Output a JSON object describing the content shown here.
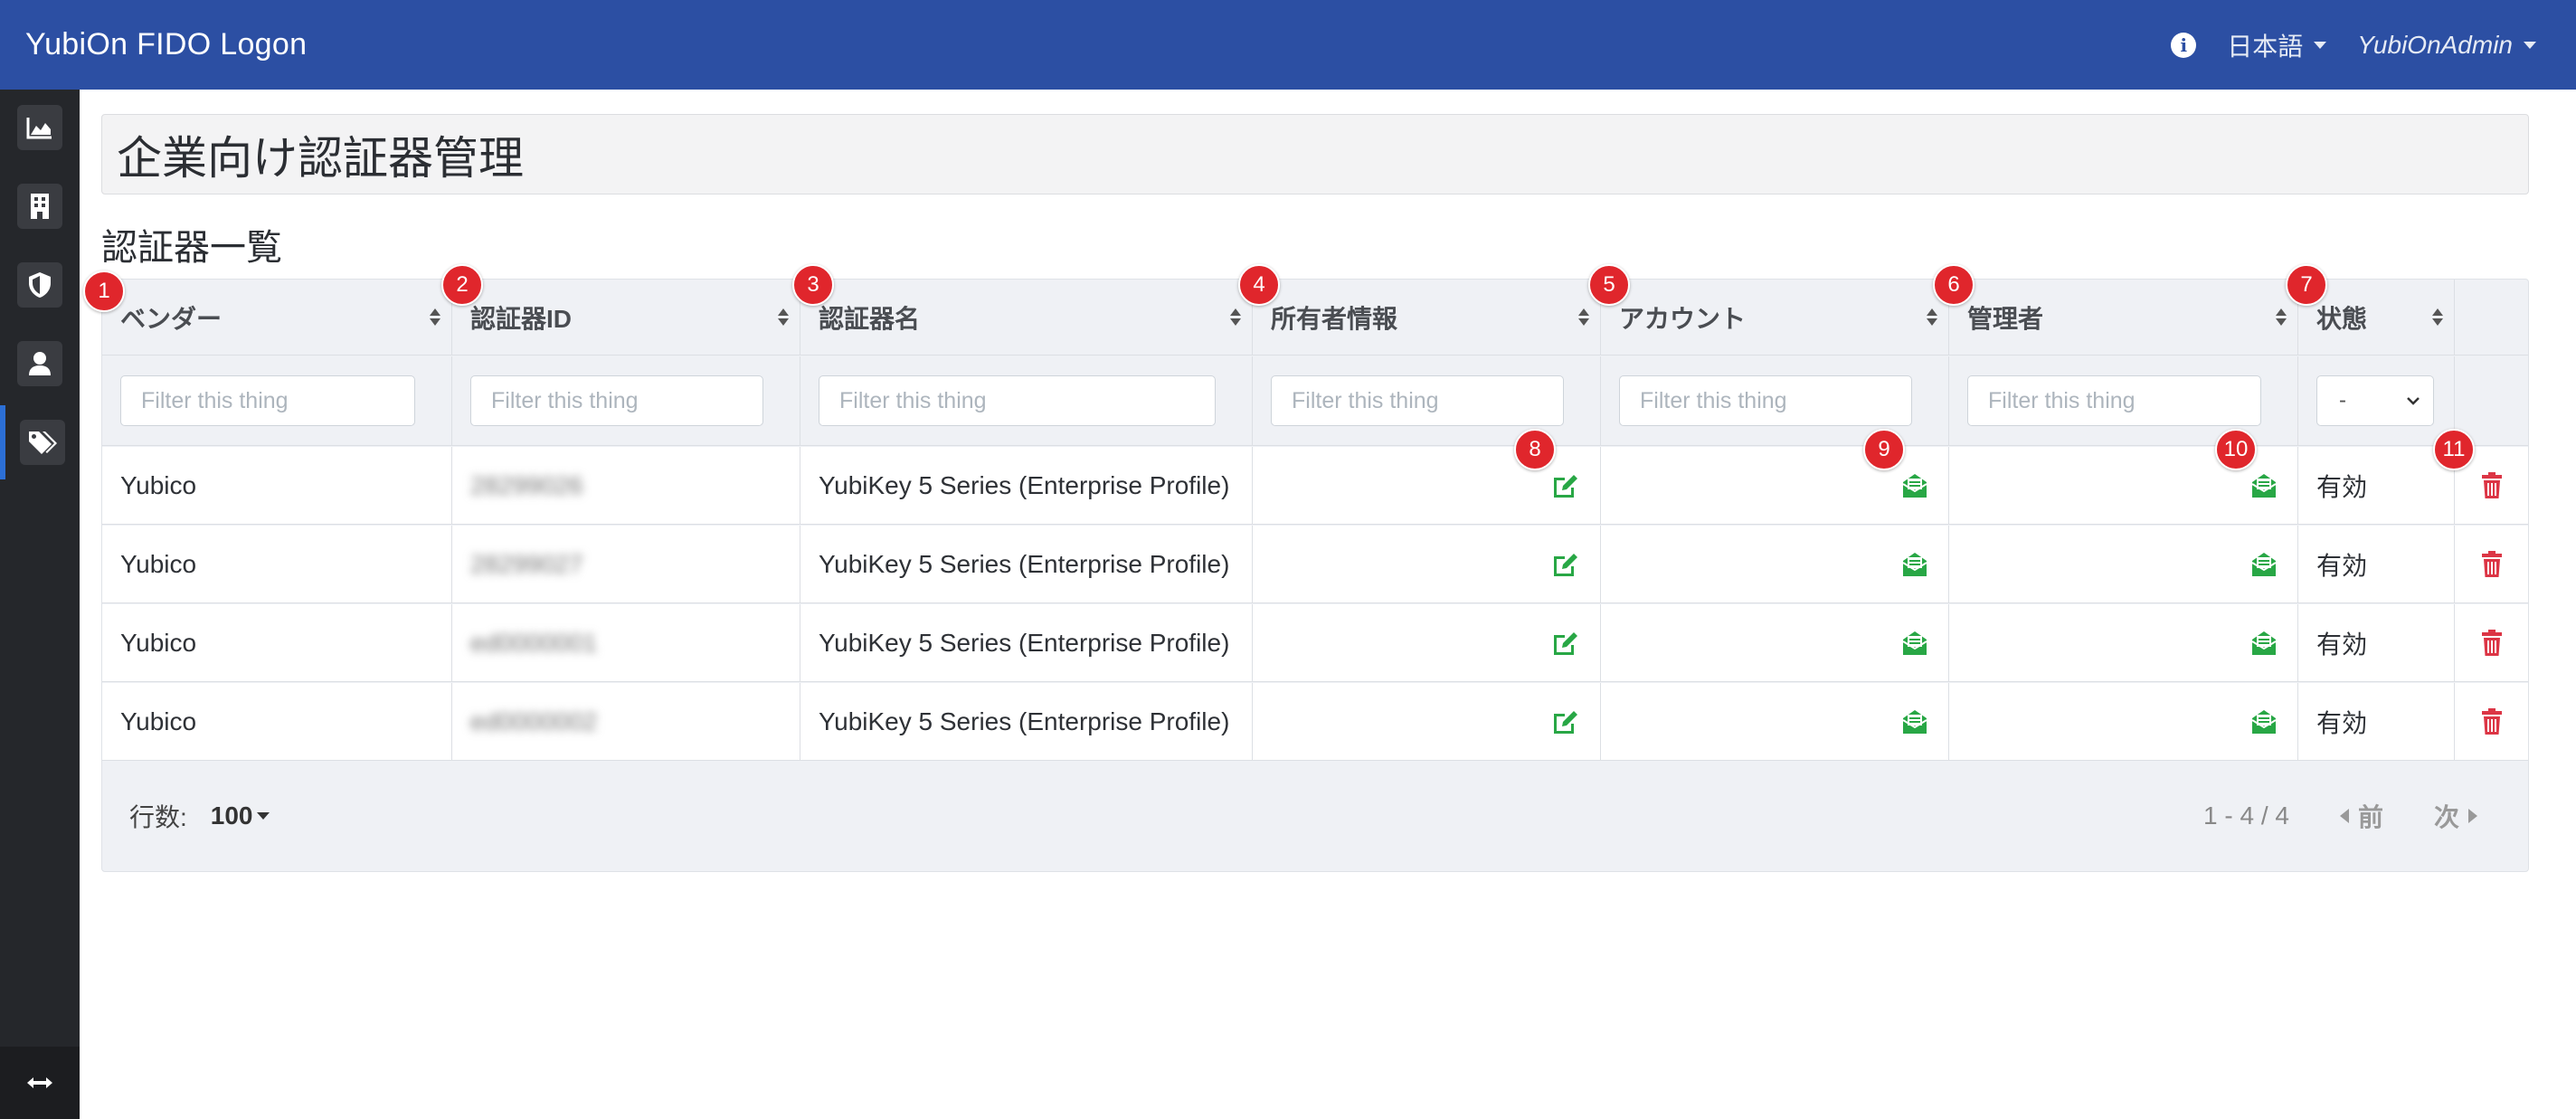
{
  "app": {
    "title": "YubiOn FIDO Logon"
  },
  "header": {
    "language": "日本語",
    "user": "YubiOnAdmin"
  },
  "sidebar": {
    "items": [
      "chart-area-icon",
      "building-icon",
      "shield-icon",
      "user-icon",
      "tags-icon"
    ],
    "active": "tags-icon",
    "toggle": "arrows-horizontal-icon"
  },
  "page": {
    "title": "企業向け認証器管理",
    "subtitle": "認証器一覧"
  },
  "table": {
    "headers": [
      "ベンダー",
      "認証器ID",
      "認証器名",
      "所有者情報",
      "アカウント",
      "管理者",
      "状態",
      ""
    ],
    "filter_placeholder": "Filter this thing",
    "status_filter": "-",
    "rows": [
      {
        "vendor": "Yubico",
        "id": "28299026",
        "name": "YubiKey 5 Series (Enterprise Profile)",
        "status": "有効"
      },
      {
        "vendor": "Yubico",
        "id": "28299027",
        "name": "YubiKey 5 Series (Enterprise Profile)",
        "status": "有効"
      },
      {
        "vendor": "Yubico",
        "id": "ed0000001",
        "name": "YubiKey 5 Series (Enterprise Profile)",
        "status": "有効"
      },
      {
        "vendor": "Yubico",
        "id": "ed0000002",
        "name": "YubiKey 5 Series (Enterprise Profile)",
        "status": "有効"
      }
    ]
  },
  "footer": {
    "rows_label": "行数:",
    "rows_value": "100",
    "range": "1 - 4 / 4",
    "prev": "前",
    "next": "次"
  },
  "annotations": [
    "1",
    "2",
    "3",
    "4",
    "5",
    "6",
    "7",
    "8",
    "9",
    "10",
    "11"
  ],
  "colors": {
    "header_bg": "#2c4fa3",
    "sidebar_bg": "#25272b",
    "action_green": "#28a745",
    "delete_red": "#dc3545",
    "badge_red": "#e0262c"
  }
}
